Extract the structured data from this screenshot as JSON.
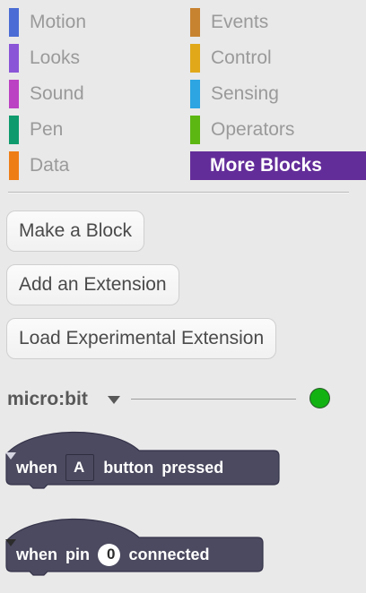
{
  "palette": {
    "categories": [
      {
        "label": "Motion",
        "color": "#4a6cd4"
      },
      {
        "label": "Looks",
        "color": "#8a55d7"
      },
      {
        "label": "Sound",
        "color": "#bb42c3"
      },
      {
        "label": "Pen",
        "color": "#0e9a6c"
      },
      {
        "label": "Data",
        "color": "#ee7d16"
      },
      {
        "label": "Events",
        "color": "#c88330"
      },
      {
        "label": "Control",
        "color": "#e1a91a"
      },
      {
        "label": "Sensing",
        "color": "#2ca5e2"
      },
      {
        "label": "Operators",
        "color": "#5cb712"
      },
      {
        "label": "More Blocks",
        "color": "#632d99",
        "selected": true
      }
    ]
  },
  "buttons": {
    "make_block": "Make a Block",
    "add_extension": "Add an Extension",
    "load_experimental": "Load Experimental Extension"
  },
  "extension": {
    "name": "micro:bit",
    "status": "connected",
    "status_color": "#12b212"
  },
  "blocks": {
    "button_pressed": {
      "when": "when",
      "dropdown_value": "A",
      "word_button": "button",
      "word_pressed": "pressed"
    },
    "pin_connected": {
      "when": "when",
      "word_pin": "pin",
      "dropdown_value": "0",
      "word_connected": "connected"
    },
    "block_color": "#4b4a60"
  }
}
